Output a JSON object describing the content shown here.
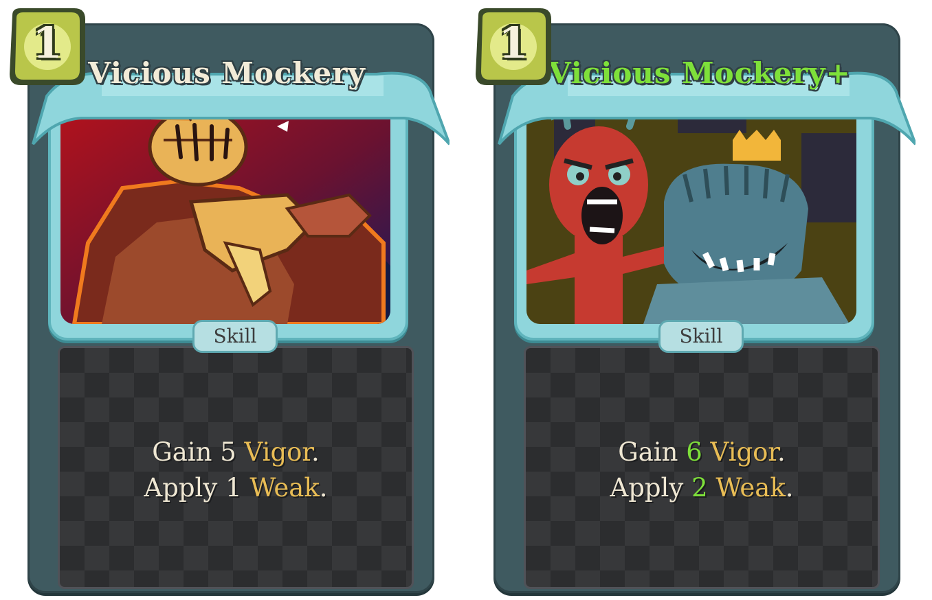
{
  "cards": [
    {
      "cost": "1",
      "title": "Vicious Mockery",
      "type": "Skill",
      "description": {
        "line1": {
          "pre": "Gain ",
          "amount": "5",
          "keyword": "Vigor",
          "end": "."
        },
        "line2": {
          "pre": "Apply ",
          "amount": "1",
          "keyword": "Weak",
          "end": "."
        }
      }
    },
    {
      "cost": "1",
      "title": "Vicious Mockery+",
      "type": "Skill",
      "description": {
        "line1": {
          "pre": "Gain ",
          "amount": "6",
          "keyword": "Vigor",
          "end": "."
        },
        "line2": {
          "pre": "Apply ",
          "amount": "2",
          "keyword": "Weak",
          "end": "."
        }
      }
    }
  ],
  "colors": {
    "frame": "#3f5a60",
    "banner": "#8fd6dc",
    "keyword": "#e9bd55",
    "upgrade": "#7ee03a",
    "cost_badge": "#b9c64a"
  }
}
